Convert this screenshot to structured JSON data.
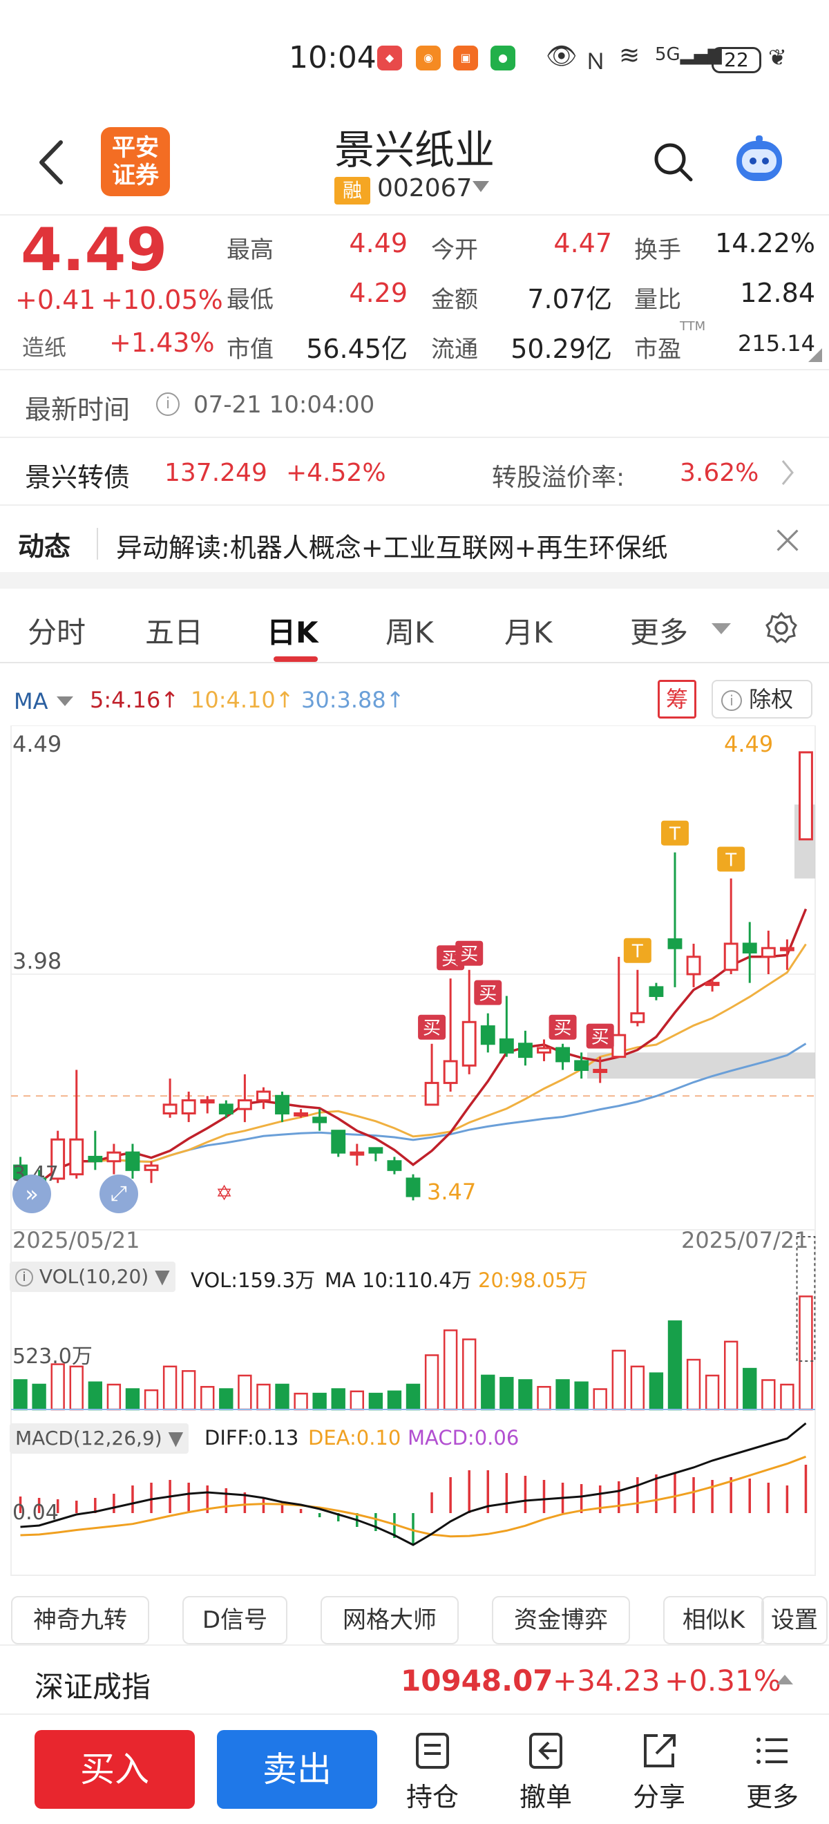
{
  "status_bar": {
    "time": "10:04",
    "battery": "22",
    "notifications": [
      "huawei-app-icon",
      "gift-app-icon",
      "pingan-app-icon",
      "wechat-icon"
    ],
    "system_icons": [
      "eye-icon",
      "nfc-icon",
      "wifi-icon",
      "5g-signal-icon",
      "leaf-icon"
    ],
    "network": "5G"
  },
  "header": {
    "title": "景兴纸业",
    "code": "002067",
    "margin_badge": "融",
    "broker_logo": "平安证券"
  },
  "quote": {
    "price": "4.49",
    "change": "+0.41",
    "change_pct": "+10.05%",
    "sector_name": "造纸",
    "sector_pct": "+1.43%",
    "fields": [
      {
        "label": "最高",
        "value": "4.49"
      },
      {
        "label": "今开",
        "value": "4.47"
      },
      {
        "label": "换手",
        "value": "14.22%"
      },
      {
        "label": "最低",
        "value": "4.29"
      },
      {
        "label": "金额",
        "value": "7.07亿"
      },
      {
        "label": "量比",
        "value": "12.84"
      },
      {
        "label": "市值",
        "value": "56.45亿"
      },
      {
        "label": "流通",
        "value": "50.29亿"
      },
      {
        "label": "市盈",
        "value": "215.14"
      }
    ],
    "pe_superscript": "TTM"
  },
  "latest_time": {
    "label": "最新时间",
    "value": "07-21 10:04:00"
  },
  "convertible": {
    "name": "景兴转债",
    "price": "137.249",
    "pct": "+4.52%",
    "premium_label": "转股溢价率:",
    "premium_value": "3.62%"
  },
  "news": {
    "label": "动态",
    "text": "异动解读:机器人概念+工业互联网+再生环保纸"
  },
  "tabs": [
    "分时",
    "五日",
    "日K",
    "周K",
    "月K",
    "更多"
  ],
  "active_tab": "日K",
  "chart_header": {
    "ma_label": "MA",
    "ma5": "5:4.16↑",
    "ma10": "10:4.10↑",
    "ma30": "30:3.88↑",
    "chip_button": "筹",
    "adjust_button": "除权"
  },
  "chart_data": {
    "type": "candlestick",
    "x_start": "2025/05/21",
    "x_end": "2025/07/21",
    "y_ticks": [
      "4.49",
      "3.98",
      "3.47"
    ],
    "max_label": "4.49",
    "min_label": "3.47",
    "ylim": [
      3.44,
      4.52
    ],
    "colors": {
      "up": "#e0343a",
      "down": "#17a04a",
      "ma5": "#c0202a",
      "ma10": "#f0b040",
      "ma30": "#6a9fd8"
    },
    "candles": [
      {
        "o": 3.54,
        "c": 3.51,
        "h": 3.56,
        "l": 3.48
      },
      {
        "o": 3.51,
        "c": 3.49,
        "h": 3.53,
        "l": 3.47
      },
      {
        "o": 3.51,
        "c": 3.6,
        "h": 3.62,
        "l": 3.5
      },
      {
        "o": 3.52,
        "c": 3.6,
        "h": 3.76,
        "l": 3.51
      },
      {
        "o": 3.56,
        "c": 3.55,
        "h": 3.62,
        "l": 3.53
      },
      {
        "o": 3.55,
        "c": 3.57,
        "h": 3.59,
        "l": 3.52
      },
      {
        "o": 3.57,
        "c": 3.53,
        "h": 3.59,
        "l": 3.51
      },
      {
        "o": 3.53,
        "c": 3.54,
        "h": 3.55,
        "l": 3.5
      },
      {
        "o": 3.66,
        "c": 3.68,
        "h": 3.74,
        "l": 3.65
      },
      {
        "o": 3.66,
        "c": 3.69,
        "h": 3.71,
        "l": 3.64
      },
      {
        "o": 3.69,
        "c": 3.69,
        "h": 3.7,
        "l": 3.66
      },
      {
        "o": 3.68,
        "c": 3.66,
        "h": 3.69,
        "l": 3.65
      },
      {
        "o": 3.67,
        "c": 3.69,
        "h": 3.75,
        "l": 3.64
      },
      {
        "o": 3.69,
        "c": 3.71,
        "h": 3.72,
        "l": 3.67
      },
      {
        "o": 3.7,
        "c": 3.66,
        "h": 3.71,
        "l": 3.64
      },
      {
        "o": 3.66,
        "c": 3.66,
        "h": 3.67,
        "l": 3.65
      },
      {
        "o": 3.65,
        "c": 3.64,
        "h": 3.67,
        "l": 3.62
      },
      {
        "o": 3.62,
        "c": 3.57,
        "h": 3.62,
        "l": 3.56
      },
      {
        "o": 3.57,
        "c": 3.57,
        "h": 3.59,
        "l": 3.54
      },
      {
        "o": 3.58,
        "c": 3.57,
        "h": 3.58,
        "l": 3.55
      },
      {
        "o": 3.55,
        "c": 3.53,
        "h": 3.56,
        "l": 3.52
      },
      {
        "o": 3.51,
        "c": 3.47,
        "h": 3.52,
        "l": 3.46
      },
      {
        "o": 3.68,
        "c": 3.73,
        "h": 3.82,
        "l": 3.68
      },
      {
        "o": 3.73,
        "c": 3.78,
        "h": 3.97,
        "l": 3.71
      },
      {
        "o": 3.77,
        "c": 3.87,
        "h": 3.99,
        "l": 3.75
      },
      {
        "o": 3.86,
        "c": 3.82,
        "h": 3.89,
        "l": 3.8
      },
      {
        "o": 3.83,
        "c": 3.8,
        "h": 3.93,
        "l": 3.79
      },
      {
        "o": 3.82,
        "c": 3.79,
        "h": 3.85,
        "l": 3.77
      },
      {
        "o": 3.8,
        "c": 3.81,
        "h": 3.83,
        "l": 3.78
      },
      {
        "o": 3.81,
        "c": 3.78,
        "h": 3.82,
        "l": 3.76
      },
      {
        "o": 3.78,
        "c": 3.76,
        "h": 3.8,
        "l": 3.74
      },
      {
        "o": 3.76,
        "c": 3.76,
        "h": 3.79,
        "l": 3.73
      },
      {
        "o": 3.79,
        "c": 3.84,
        "h": 4.02,
        "l": 3.79
      },
      {
        "o": 3.87,
        "c": 3.89,
        "h": 3.99,
        "l": 3.86
      },
      {
        "o": 3.95,
        "c": 3.93,
        "h": 3.96,
        "l": 3.92
      },
      {
        "o": 4.06,
        "c": 4.04,
        "h": 4.26,
        "l": 3.95
      },
      {
        "o": 3.98,
        "c": 4.02,
        "h": 4.05,
        "l": 3.95
      },
      {
        "o": 3.96,
        "c": 3.96,
        "h": 3.97,
        "l": 3.94
      },
      {
        "o": 3.99,
        "c": 4.05,
        "h": 4.2,
        "l": 3.98
      },
      {
        "o": 4.05,
        "c": 4.03,
        "h": 4.1,
        "l": 3.96
      },
      {
        "o": 4.02,
        "c": 4.04,
        "h": 4.08,
        "l": 3.98
      },
      {
        "o": 4.04,
        "c": 4.04,
        "h": 4.06,
        "l": 3.99
      },
      {
        "o": 4.29,
        "c": 4.49,
        "h": 4.49,
        "l": 4.29
      }
    ],
    "signals": [
      "买",
      "买",
      "买",
      "买",
      "买",
      "买",
      "T",
      "T",
      "T"
    ],
    "volume": {
      "label": "VOL(10,20)",
      "vol": "VOL:159.3万",
      "ma10": "MA 10:110.4万",
      "ma20": "20:98.05万",
      "max_tick": "523.0万"
    },
    "macd": {
      "label": "MACD(12,26,9)",
      "diff": "DIFF:0.13",
      "dea": "DEA:0.10",
      "macd": "MACD:0.06",
      "tick": "0.04"
    }
  },
  "tool_chips": [
    "神奇九转",
    "D信号",
    "网格大师",
    "资金博弈",
    "相似K",
    "设置"
  ],
  "index_bar": {
    "name": "深证成指",
    "value": "10948.07",
    "change": "+34.23",
    "pct": "+0.31%"
  },
  "bottom_actions": {
    "buy": "买入",
    "sell": "卖出",
    "items": [
      "持仓",
      "撤单",
      "分享",
      "更多"
    ]
  }
}
